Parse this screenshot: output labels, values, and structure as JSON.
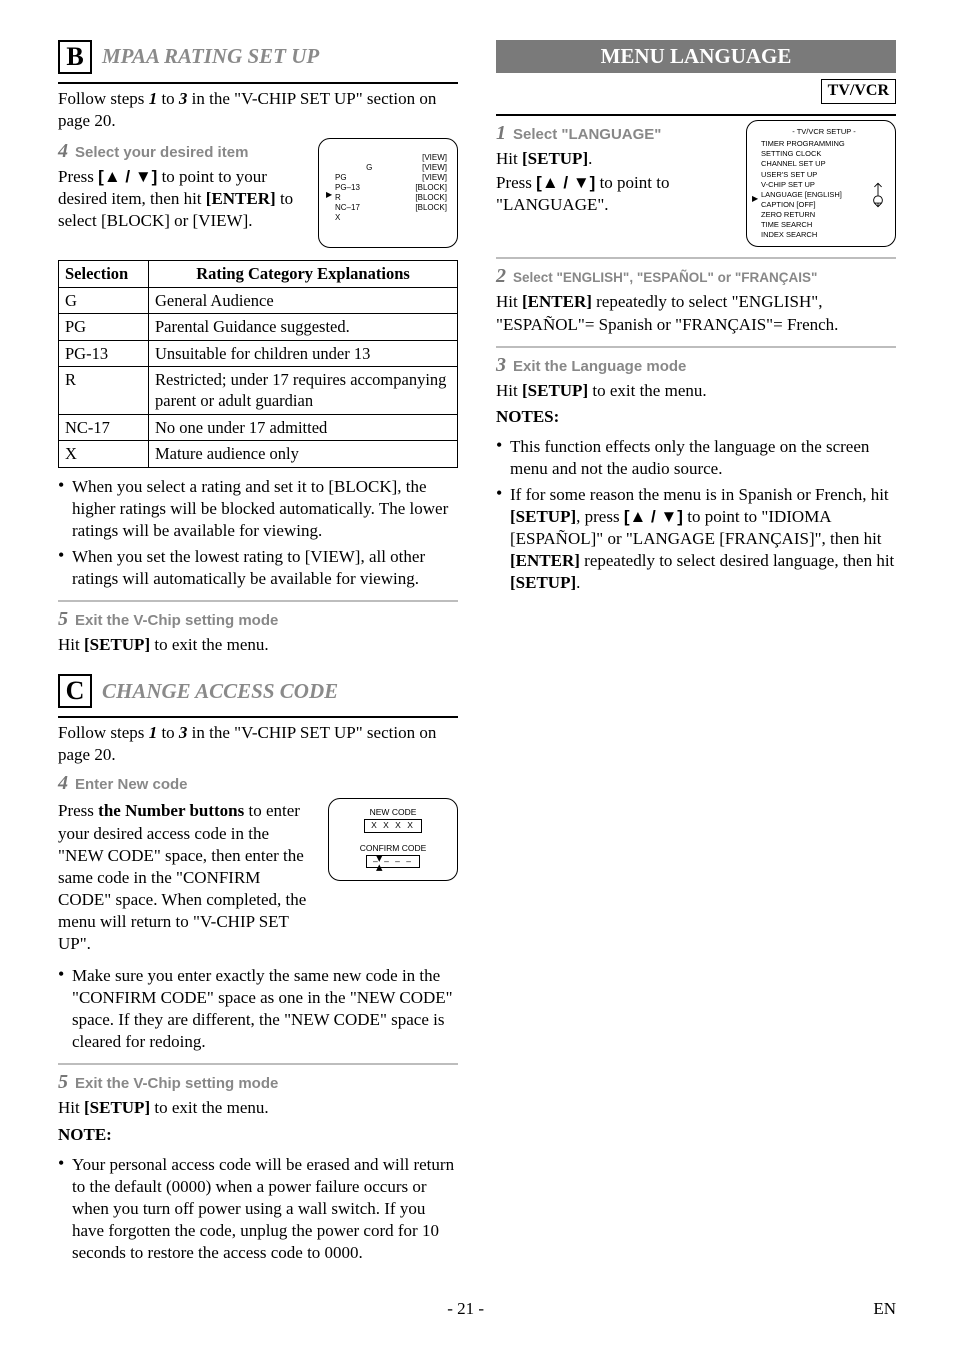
{
  "left": {
    "sectionB": {
      "letter": "B",
      "title": "MPAA RATING SET UP",
      "intro_a": "Follow steps ",
      "intro_b": " to ",
      "intro_c": " in the \"V-CHIP SET UP\" section on page 20.",
      "steps_ref_1": "1",
      "steps_ref_3": "3",
      "step4": {
        "num": "4",
        "label": "Select your desired item",
        "body_a": "Press ",
        "body_b": "[▲ / ▼]",
        "body_c": " to point to your desired item, then hit ",
        "body_d": "[ENTER]",
        "body_e": " to select [BLOCK] or [VIEW]."
      },
      "osd_rating": {
        "left": "G\nPG\nPG–13\nR\nNC–17\nX",
        "right": "[VIEW]\n[VIEW]\n[VIEW]\n[BLOCK]\n[BLOCK]\n[BLOCK]",
        "cursor": "▶"
      },
      "table": {
        "h1": "Selection",
        "h2": "Rating Category Explanations",
        "rows": [
          [
            "G",
            "General Audience"
          ],
          [
            "PG",
            "Parental Guidance suggested."
          ],
          [
            "PG-13",
            "Unsuitable for children under 13"
          ],
          [
            "R",
            "Restricted; under 17 requires accompanying parent or adult guardian"
          ],
          [
            "NC-17",
            "No one under 17 admitted"
          ],
          [
            "X",
            "Mature audience only"
          ]
        ]
      },
      "bullets": [
        "When you select a rating and set it to [BLOCK], the higher ratings will be blocked automatically. The lower ratings will be available for viewing.",
        "When you set the lowest rating to [VIEW], all other ratings will automatically be available for viewing."
      ],
      "step5": {
        "num": "5",
        "label": "Exit the V-Chip setting mode",
        "body_a": "Hit ",
        "body_b": "[SETUP]",
        "body_c": " to exit the menu."
      }
    },
    "sectionC": {
      "letter": "C",
      "title": "CHANGE ACCESS CODE",
      "intro_a": "Follow steps ",
      "intro_b": " to ",
      "intro_c": " in the \"V-CHIP SET UP\" section on page 20.",
      "steps_ref_1": "1",
      "steps_ref_3": "3",
      "step4": {
        "num": "4",
        "label": "Enter New code",
        "body_a": "Press ",
        "body_b": "the Number buttons",
        "body_c": " to enter your desired access code in the \"NEW CODE\" space, then enter the same code in the \"CONFIRM CODE\" space. When completed, the menu will return to \"V-CHIP SET UP\"."
      },
      "osd_code": {
        "new_label": "NEW CODE",
        "new_val": "X X X X",
        "confirm_label": "CONFIRM CODE",
        "confirm_val": "– – – –"
      },
      "bullet4": "Make sure you enter exactly the same new code in the \"CONFIRM CODE\" space as one in the \"NEW CODE\" space. If they are different, the \"NEW CODE\" space is cleared for redoing.",
      "step5": {
        "num": "5",
        "label": "Exit the V-Chip setting mode",
        "body_a": "Hit ",
        "body_b": "[SETUP]",
        "body_c": " to exit the menu."
      },
      "note_head": "NOTE:",
      "note_bullet": "Your personal access code will be erased and will return to the default (0000) when a power failure occurs or when you turn off power using a wall switch. If you have forgotten the code, unplug the power cord for 10 seconds to restore the access code to 0000."
    }
  },
  "right": {
    "banner": "MENU LANGUAGE",
    "tvvcr": "TV/VCR",
    "step1": {
      "num": "1",
      "label": "Select \"LANGUAGE\"",
      "body_a": "Hit ",
      "body_b": "[SETUP]",
      "body_c": ".",
      "body_d": "Press ",
      "body_e": "[▲ / ▼]",
      "body_f": " to point to \"LANGUAGE\"."
    },
    "osd_menu": {
      "title": "- TV/VCR SETUP -",
      "items": [
        "TIMER PROGRAMMING",
        "SETTING CLOCK",
        "CHANNEL SET UP",
        "USER'S SET UP",
        "V-CHIP SET UP",
        "LANGUAGE   [ENGLISH]",
        "CAPTION   [OFF]",
        "ZERO RETURN",
        "TIME SEARCH",
        "INDEX SEARCH"
      ],
      "cursor": "▶"
    },
    "step2": {
      "num": "2",
      "label": "Select \"ENGLISH\", \"ESPAÑOL\" or \"FRANÇAIS\"",
      "body_a": "Hit ",
      "body_b": "[ENTER]",
      "body_c": " repeatedly to select \"ENGLISH\", \"ESPAÑOL\"= Spanish or \"FRANÇAIS\"= French."
    },
    "step3": {
      "num": "3",
      "label": "Exit the Language mode",
      "body_a": "Hit ",
      "body_b": "[SETUP]",
      "body_c": " to exit the menu."
    },
    "notes_head": "NOTES:",
    "notes": [
      "This function effects only the language on the screen menu and not the audio source.",
      {
        "a": "If for some reason the menu is in Spanish or French, hit ",
        "b": "[SETUP]",
        "c": ", press ",
        "d": "[▲ / ▼]",
        "e": " to point to \"IDIOMA [ESPAÑOL]\" or \"LANGAGE [FRANÇAIS]\", then hit ",
        "f": "[ENTER]",
        "g": " repeatedly to select desired language, then hit ",
        "h": "[SETUP]",
        "i": "."
      }
    ]
  },
  "footer": {
    "page": "- 21 -",
    "code": "EN"
  }
}
